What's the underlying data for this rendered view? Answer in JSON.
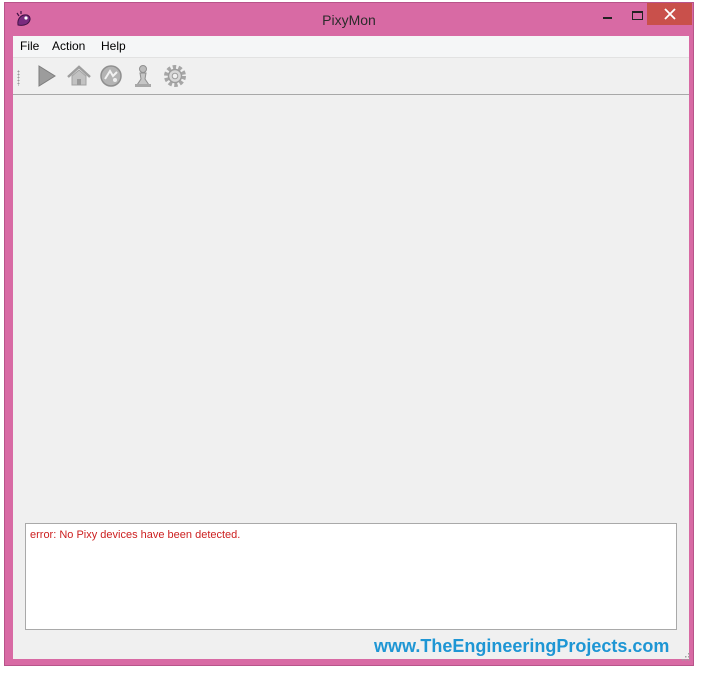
{
  "window": {
    "title": "PixyMon",
    "icons": {
      "app": "pixy-app-icon",
      "minimize": "minimize-icon",
      "maximize": "maximize-icon",
      "close": "close-icon"
    },
    "colors": {
      "frame": "#d86aa4",
      "close_button": "#c9504b",
      "client": "#f0f0f0"
    }
  },
  "menu": {
    "items": [
      {
        "label": "File"
      },
      {
        "label": "Action"
      },
      {
        "label": "Help"
      }
    ]
  },
  "toolbar": {
    "buttons": [
      {
        "icon": "play-icon"
      },
      {
        "icon": "home-icon"
      },
      {
        "icon": "raw-video-icon"
      },
      {
        "icon": "chess-pawn-icon"
      },
      {
        "icon": "gear-icon"
      }
    ]
  },
  "console": {
    "lines": [
      {
        "text": "error: No Pixy devices have been detected.",
        "color": "#cc1f1f"
      }
    ]
  },
  "watermark": {
    "text": "www.TheEngineeringProjects.com",
    "color": "#1e96d4"
  }
}
